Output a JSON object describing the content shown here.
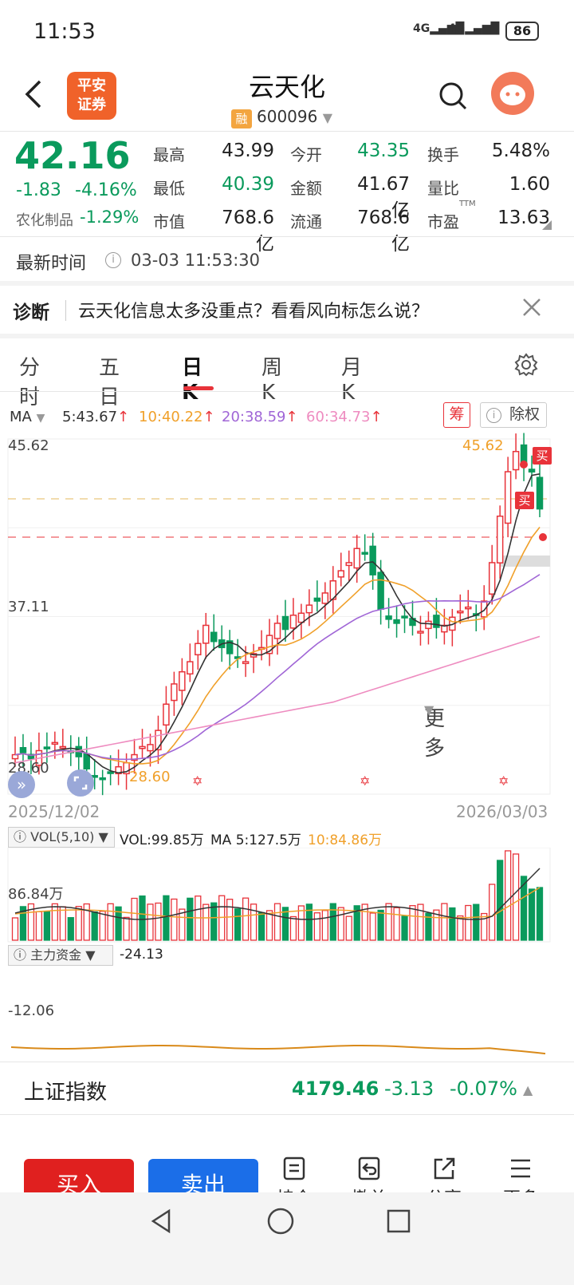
{
  "status_bar": {
    "time": "11:53",
    "signal1": "4G",
    "signal2": "4G",
    "battery": "86"
  },
  "header": {
    "logo_line1": "平安",
    "logo_line2": "证券",
    "title": "云天化",
    "margin_tag": "融",
    "code": "600096"
  },
  "quote": {
    "price": "42.16",
    "change": "-1.83",
    "change_pct": "-4.16%",
    "sector": "农化制品",
    "sector_pct": "-1.29%",
    "stats": [
      {
        "label": "最高",
        "value": "43.99",
        "color": "#222"
      },
      {
        "label": "今开",
        "value": "43.35",
        "color": "#0a9a5c"
      },
      {
        "label": "换手",
        "value": "5.48%",
        "color": "#222"
      },
      {
        "label": "最低",
        "value": "40.39",
        "color": "#0a9a5c"
      },
      {
        "label": "金额",
        "value": "41.67亿",
        "color": "#222"
      },
      {
        "label": "量比",
        "value": "1.60",
        "color": "#222"
      },
      {
        "label": "市值",
        "value": "768.6亿",
        "color": "#222"
      },
      {
        "label": "流通",
        "value": "768.6亿",
        "color": "#222"
      },
      {
        "label": "市盈",
        "value": "13.63",
        "color": "#222"
      }
    ],
    "pe_sup": "TTM"
  },
  "update": {
    "label": "最新时间",
    "time": "03-03 11:53:30"
  },
  "diagnosis": {
    "label": "诊断",
    "text": "云天化信息太多没重点？看看风向标怎么说？"
  },
  "tabs": [
    "分时",
    "五日",
    "日K",
    "周K",
    "月K",
    "更多"
  ],
  "active_tab": "日K",
  "ma_legend": {
    "label": "MA",
    "ma5": "5:43.67",
    "ma10": "10:40.22",
    "ma20": "20:38.59",
    "ma60": "60:34.73",
    "chip": "筹",
    "adjust": "除权"
  },
  "chart": {
    "y_high": "45.62",
    "y_mid": "37.11",
    "y_low": "28.60",
    "max_marker": "45.62",
    "min_marker": "28.60",
    "buy_tag": "买",
    "date_start": "2025/12/02",
    "date_end": "2026/03/03"
  },
  "volume": {
    "label": "VOL(5,10)",
    "vol": "VOL:99.85万",
    "ma5": "MA 5:127.5万",
    "ma10": "10:84.86万",
    "axis": "86.84万"
  },
  "capital": {
    "label": "主力资金",
    "value": "-24.13",
    "axis": "-12.06"
  },
  "index": {
    "name": "上证指数",
    "value": "4179.46",
    "change": "-3.13",
    "pct": "-0.07%"
  },
  "actions": {
    "buy": "买入",
    "sell": "卖出",
    "tools": [
      "持仓",
      "撤单",
      "分享",
      "更多"
    ]
  },
  "colors": {
    "up": "#e8333a",
    "down": "#0a9a5c",
    "buy_btn": "#e0201f",
    "sell_btn": "#1b6ee8",
    "ma5": "#333333",
    "ma10": "#f0a02a",
    "ma20": "#a066d6",
    "ma60": "#ee8cc0"
  },
  "chart_data": {
    "type": "candlestick",
    "y_axis_ticks": [
      "45.62",
      "37.11",
      "28.60"
    ],
    "x_range": [
      "2025/12/02",
      "2026/03/03"
    ],
    "latest": {
      "close": 42.16,
      "high": 43.99,
      "low": 40.39,
      "open": 43.35
    },
    "ma": {
      "ma5": 43.67,
      "ma10": 40.22,
      "ma20": 38.59,
      "ma60": 34.73
    }
  }
}
